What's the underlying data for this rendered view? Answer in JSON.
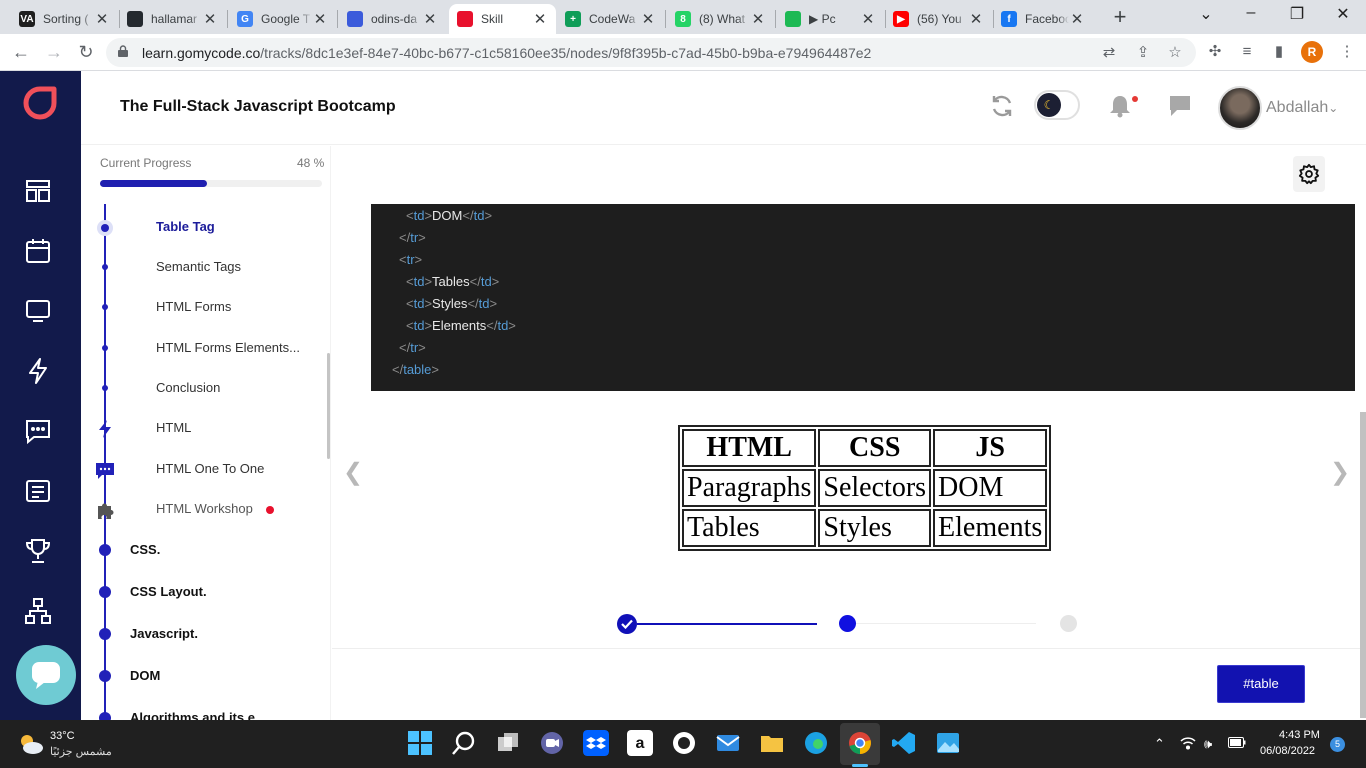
{
  "browser": {
    "tabs": [
      {
        "title": "Sorting (",
        "favicon_text": "VA",
        "favicon_color": "#1f1f1f"
      },
      {
        "title": "hallamar",
        "favicon_text": "",
        "favicon_color": "#24292f"
      },
      {
        "title": "Google T",
        "favicon_text": "G",
        "favicon_color": "#4285f4"
      },
      {
        "title": "odins-da",
        "favicon_text": "",
        "favicon_color": "#3b5bdb"
      },
      {
        "title": "Skill",
        "favicon_text": "",
        "favicon_color": "#e8112d"
      },
      {
        "title": "CodeWa",
        "favicon_text": "+",
        "favicon_color": "#0f9d58"
      },
      {
        "title": "(8) What",
        "favicon_text": "8",
        "favicon_color": "#25d366"
      },
      {
        "title": "▶ Pc",
        "favicon_text": "",
        "favicon_color": "#1db954"
      },
      {
        "title": "(56) You",
        "favicon_text": "▶",
        "favicon_color": "#ff0000"
      },
      {
        "title": "Faceboo",
        "favicon_text": "f",
        "favicon_color": "#1877f2"
      }
    ],
    "active_tab_index": 4,
    "url_host": "learn.gomycode.co",
    "url_path": "/tracks/8dc1e3ef-84e7-40bc-b677-c1c58160ee35/nodes/9f8f395b-c7ad-45b0-b9ba-e794964487e2",
    "profile_initial": "R"
  },
  "header": {
    "course_title": "The Full-Stack Javascript Bootcamp",
    "username": "Abdallah"
  },
  "sidebar": {
    "progress_label": "Current Progress",
    "progress_percent_text": "48 %",
    "progress_value": 0.48,
    "items": [
      {
        "label": "Table Tag",
        "kind": "sub",
        "state": "current"
      },
      {
        "label": "Semantic Tags",
        "kind": "sub"
      },
      {
        "label": "HTML Forms",
        "kind": "sub"
      },
      {
        "label": "HTML Forms Elements...",
        "kind": "sub"
      },
      {
        "label": "Conclusion",
        "kind": "sub"
      },
      {
        "label": "HTML",
        "kind": "sub",
        "icon": "lightning-icon"
      },
      {
        "label": "HTML One To One",
        "kind": "sub",
        "icon": "chat-icon"
      },
      {
        "label": "HTML Workshop",
        "kind": "sub",
        "icon": "puzzle-icon",
        "state": "faded",
        "alert": true
      },
      {
        "label": "CSS.",
        "kind": "top"
      },
      {
        "label": "CSS Layout.",
        "kind": "top"
      },
      {
        "label": "Javascript.",
        "kind": "top"
      },
      {
        "label": "DOM",
        "kind": "top"
      },
      {
        "label": "Algorithms and its e...",
        "kind": "top"
      }
    ]
  },
  "code": {
    "lines": [
      {
        "indent": "    ",
        "open": "td",
        "text": "DOM",
        "close": "td"
      },
      {
        "indent": "  ",
        "close_only": "tr"
      },
      {
        "indent": "  ",
        "open_only": "tr"
      },
      {
        "indent": "    ",
        "open": "td",
        "text": "Tables",
        "close": "td"
      },
      {
        "indent": "    ",
        "open": "td",
        "text": "Styles",
        "close": "td"
      },
      {
        "indent": "    ",
        "open": "td",
        "text": "Elements",
        "close": "td"
      },
      {
        "indent": "  ",
        "close_only": "tr"
      },
      {
        "indent": "",
        "close_only": "table"
      }
    ]
  },
  "rendered_table": {
    "headers": [
      "HTML",
      "CSS",
      "JS"
    ],
    "rows": [
      [
        "Paragraphs",
        "Selectors",
        "DOM"
      ],
      [
        "Tables",
        "Styles",
        "Elements"
      ]
    ]
  },
  "stepper": {
    "total": 3,
    "current": 2
  },
  "tag_button": "#table",
  "taskbar": {
    "temperature": "33°C",
    "weather_desc": "مشمس جزئيًا",
    "time": "4:43 PM",
    "date": "06/08/2022",
    "notification_count": "5"
  },
  "colors": {
    "rail": "#121a4b",
    "accent": "#2121b8",
    "brand_logo": "#f0505a",
    "code_bg": "#1e1e1e",
    "tag_button": "#1212b0"
  }
}
